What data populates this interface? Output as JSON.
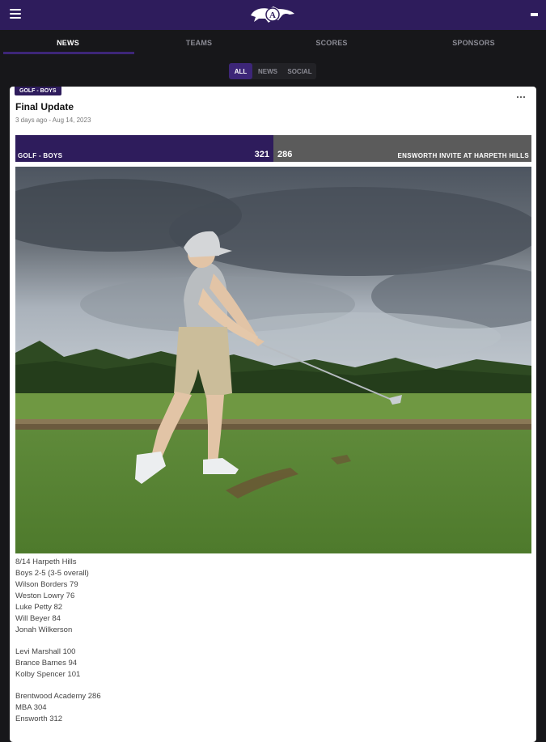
{
  "app": {
    "logo_icon": "mustang-logo-icon",
    "menu_icon": "hamburger-menu-icon",
    "more_icon": "more-icon",
    "colors": {
      "brand": "#2e1c5c",
      "background": "#17171a",
      "accent": "#3d2678"
    }
  },
  "nav": {
    "tabs": [
      {
        "label": "NEWS",
        "active": true
      },
      {
        "label": "TEAMS",
        "active": false
      },
      {
        "label": "SCORES",
        "active": false
      },
      {
        "label": "SPONSORS",
        "active": false
      }
    ]
  },
  "filter": {
    "options": [
      {
        "label": "ALL",
        "active": true
      },
      {
        "label": "NEWS",
        "active": false
      },
      {
        "label": "SOCIAL",
        "active": false
      }
    ]
  },
  "post": {
    "badge": "GOLF - BOYS",
    "title": "Final Update",
    "meta": "3 days ago - Aug 14, 2023",
    "score": {
      "team": "GOLF - BOYS",
      "home_score": "321",
      "away_score": "286",
      "event": "ENSWORTH INVITE AT HARPETH HILLS"
    },
    "lines": [
      "8/14 Harpeth Hills",
      "Boys 2-5 (3-5 overall)",
      "Wilson Borders 79",
      "Weston Lowry 76",
      "Luke Petty 82",
      "Will Beyer 84",
      "Jonah Wilkerson",
      "",
      "Levi Marshall 100",
      "Brance Barnes 94",
      "Kolby Spencer 101",
      "",
      "Brentwood Academy 286",
      "MBA 304",
      "Ensworth 312"
    ]
  }
}
